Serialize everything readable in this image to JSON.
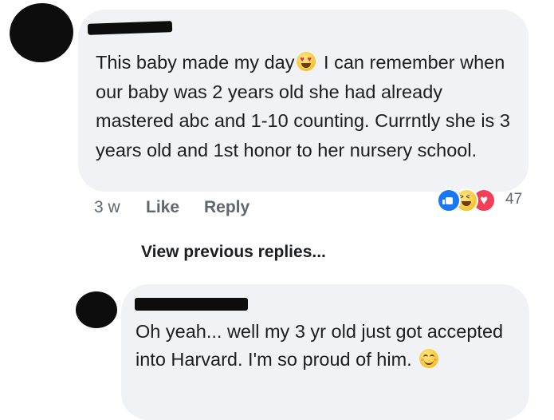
{
  "comment1": {
    "text_part1": "This baby made my day",
    "text_part2": " I can remember when our baby was 2 years old she had already mastered abc and 1-10 counting. Currntly she is 3 years old and 1st honor to her nursery school.",
    "emoji": "heart-eyes-emoji",
    "timestamp": "3 w",
    "like_label": "Like",
    "reply_label": "Reply",
    "reaction_icons": [
      "like-reaction-icon",
      "haha-reaction-icon",
      "love-reaction-icon"
    ],
    "reaction_count": "47"
  },
  "view_previous_label": "View previous replies...",
  "comment2": {
    "text_part1": "Oh yeah... well my 3 yr old just got accepted into Harvard.  I'm so proud of him.",
    "emoji": "smiling-face-emoji"
  },
  "colors": {
    "bubble": "#f0f2f5",
    "text": "#1c1e21",
    "meta": "#606770",
    "like_blue": "#1877f2",
    "love_red": "#f33e58",
    "emoji_yellow": "#f7c433"
  }
}
